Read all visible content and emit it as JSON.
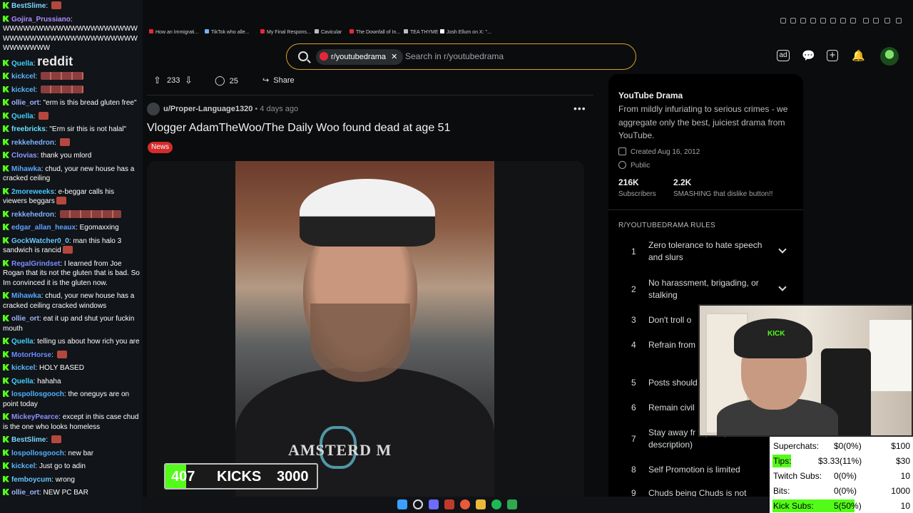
{
  "chat": {
    "messages": [
      {
        "user": "BestSlime",
        "color": "#7ad7ff",
        "text": "",
        "emote": "single"
      },
      {
        "user": "Gojira_Prussiano",
        "color": "#b08cff",
        "text": "WWWWWWWWWWWWWWWWWWWWWWWWWWWWWWWWWWWWWWWWWWWWWWW"
      },
      {
        "user": "Quella",
        "color": "#3fd1ff",
        "text": "reddit"
      },
      {
        "user": "kickcel",
        "color": "#5bb6ff",
        "text": "",
        "emote": "wide"
      },
      {
        "user": "kickcel",
        "color": "#5bb6ff",
        "text": "",
        "emote": "wide"
      },
      {
        "user": "ollie_ort",
        "color": "#9fb4ff",
        "text": "\"erm is this bread gluten free\""
      },
      {
        "user": "Quella",
        "color": "#3fd1ff",
        "text": "",
        "emote": "single"
      },
      {
        "user": "freebricks",
        "color": "#66e3ff",
        "text": "\"Erm sir this is not halal\""
      },
      {
        "user": "rekkehedron",
        "color": "#7fb2ff",
        "text": "",
        "emote": "single"
      },
      {
        "user": "Clovias",
        "color": "#8f9bff",
        "text": "thank you mlord"
      },
      {
        "user": "Mihawka",
        "color": "#56a8ff",
        "text": "chud, your new house has a cracked ceiling"
      },
      {
        "user": "2moreweeks",
        "color": "#49c6ff",
        "text": "e-beggar calls his viewers beggars",
        "emote": "single"
      },
      {
        "user": "rekkehedron",
        "color": "#7fb2ff",
        "text": "",
        "emote": "xwide"
      },
      {
        "user": "edgar_allan_heaux",
        "color": "#60a0ff",
        "text": "Egomaxxing"
      },
      {
        "user": "GockWatcher0_0",
        "color": "#66c9ff",
        "text": "man this halo 3 sandwich is rancid",
        "emote": "single"
      },
      {
        "user": "RegalGrindset",
        "color": "#7b8cff",
        "text": "I learned from Joe Rogan that its not the gluten that is bad. So Im convinced it is the gluten now."
      },
      {
        "user": "Mihawka",
        "color": "#56a8ff",
        "text": "chud, your new house has a cracked ceiling cracked windows"
      },
      {
        "user": "ollie_ort",
        "color": "#9fb4ff",
        "text": "eat it up and shut your fuckin mouth"
      },
      {
        "user": "Quella",
        "color": "#3fd1ff",
        "text": "telling us about how rich you are"
      },
      {
        "user": "MotorHorse",
        "color": "#6b8cff",
        "text": "",
        "emote": "single"
      },
      {
        "user": "kickcel",
        "color": "#5bb6ff",
        "text": "HOLY BASED"
      },
      {
        "user": "Quella",
        "color": "#3fd1ff",
        "text": "hahaha"
      },
      {
        "user": "lospollosgooch",
        "color": "#4fb0ff",
        "text": "the oneguys are on point today"
      },
      {
        "user": "MickeyPearce",
        "color": "#8f8fff",
        "text": "except in this case chud is the one who looks homeless"
      },
      {
        "user": "BestSlime",
        "color": "#7ad7ff",
        "text": "",
        "emote": "single"
      },
      {
        "user": "lospollosgooch",
        "color": "#4fb0ff",
        "text": "new bar"
      },
      {
        "user": "kickcel",
        "color": "#5bb6ff",
        "text": "Just go to adin"
      },
      {
        "user": "femboycum",
        "color": "#63c4ff",
        "text": "wrong"
      },
      {
        "user": "ollie_ort",
        "color": "#9fb4ff",
        "text": "NEW PC BAR"
      }
    ]
  },
  "bookmarks": [
    {
      "label": "How an Immigrati...",
      "color": "#e8263a"
    },
    {
      "label": "TikTok who alle...",
      "color": "#6fb3ff"
    },
    {
      "label": "My Final Respons...",
      "color": "#e8263a"
    },
    {
      "label": "Cavicular",
      "color": "#bdbdbd"
    },
    {
      "label": "The Downfall of In...",
      "color": "#e8263a"
    },
    {
      "label": "TEA THYME",
      "color": "#bdbdbd"
    },
    {
      "label": "Josh Ellum on X: \"...",
      "color": "#ffffff"
    }
  ],
  "search": {
    "subreddit": "r/youtubedrama",
    "placeholder": "Search in r/youtubedrama"
  },
  "post": {
    "upvotes": "233",
    "comments": "25",
    "share_label": "Share",
    "author": "u/Proper-Language1320",
    "age": "4 days ago",
    "title": "Vlogger AdamTheWoo/The Daily Woo found dead at age 51",
    "flair": "News",
    "shirt_text": "AMSTERD M"
  },
  "kicks_goal": {
    "current": "407",
    "label": "KICKS",
    "goal": "3000",
    "progress_fraction": 0.136,
    "fill_color": "#53fc18"
  },
  "sidebar": {
    "title": "YouTube Drama",
    "description": "From mildly infuriating to serious crimes - we aggregate only the best, juiciest drama from YouTube.",
    "created": "Created Aug 16, 2012",
    "visibility": "Public",
    "subscribers_count": "216K",
    "subscribers_label": "Subscribers",
    "online_count": "2.2K",
    "online_label": "SMASHING that dislike button!!",
    "rules_title": "R/YOUTUBEDRAMA RULES",
    "rules": [
      {
        "num": "1",
        "text": "Zero tolerance to hate speech and slurs",
        "expandable": true
      },
      {
        "num": "2",
        "text": "No harassment, brigading, or stalking",
        "expandable": true
      },
      {
        "num": "3",
        "text": "Don't troll o",
        "expandable": false
      },
      {
        "num": "4",
        "text": "Refrain from and spreadin",
        "expandable": false
      },
      {
        "num": "5",
        "text": "Posts should",
        "expandable": false
      },
      {
        "num": "6",
        "text": "Remain civil",
        "expandable": false
      },
      {
        "num": "7",
        "text": "Stay away fr topics (list in description)",
        "expandable": false
      },
      {
        "num": "8",
        "text": "Self Promotion is limited",
        "expandable": false
      },
      {
        "num": "9",
        "text": "Chuds being Chuds is not",
        "expandable": false
      }
    ]
  },
  "webcam": {
    "hat_text": "KICK"
  },
  "stats": [
    {
      "label": "Superchats:",
      "value": "$0(0%)",
      "goal": "$100",
      "highlight": ""
    },
    {
      "label": "Tips:",
      "value": "$3.33(11%)",
      "goal": "$30",
      "highlight": "#53fc18"
    },
    {
      "label": "Twitch Subs:",
      "value": "0(0%)",
      "goal": "10",
      "highlight": ""
    },
    {
      "label": "Bits:",
      "value": "0(0%)",
      "goal": "1000",
      "highlight": ""
    },
    {
      "label": "Kick Subs:",
      "value": "5(50%)",
      "goal": "10",
      "highlight": "#53fc18"
    }
  ],
  "colors": {
    "accent": "#53fc18",
    "reddit_orange": "#d8a327",
    "flair": "#d42b2b"
  }
}
